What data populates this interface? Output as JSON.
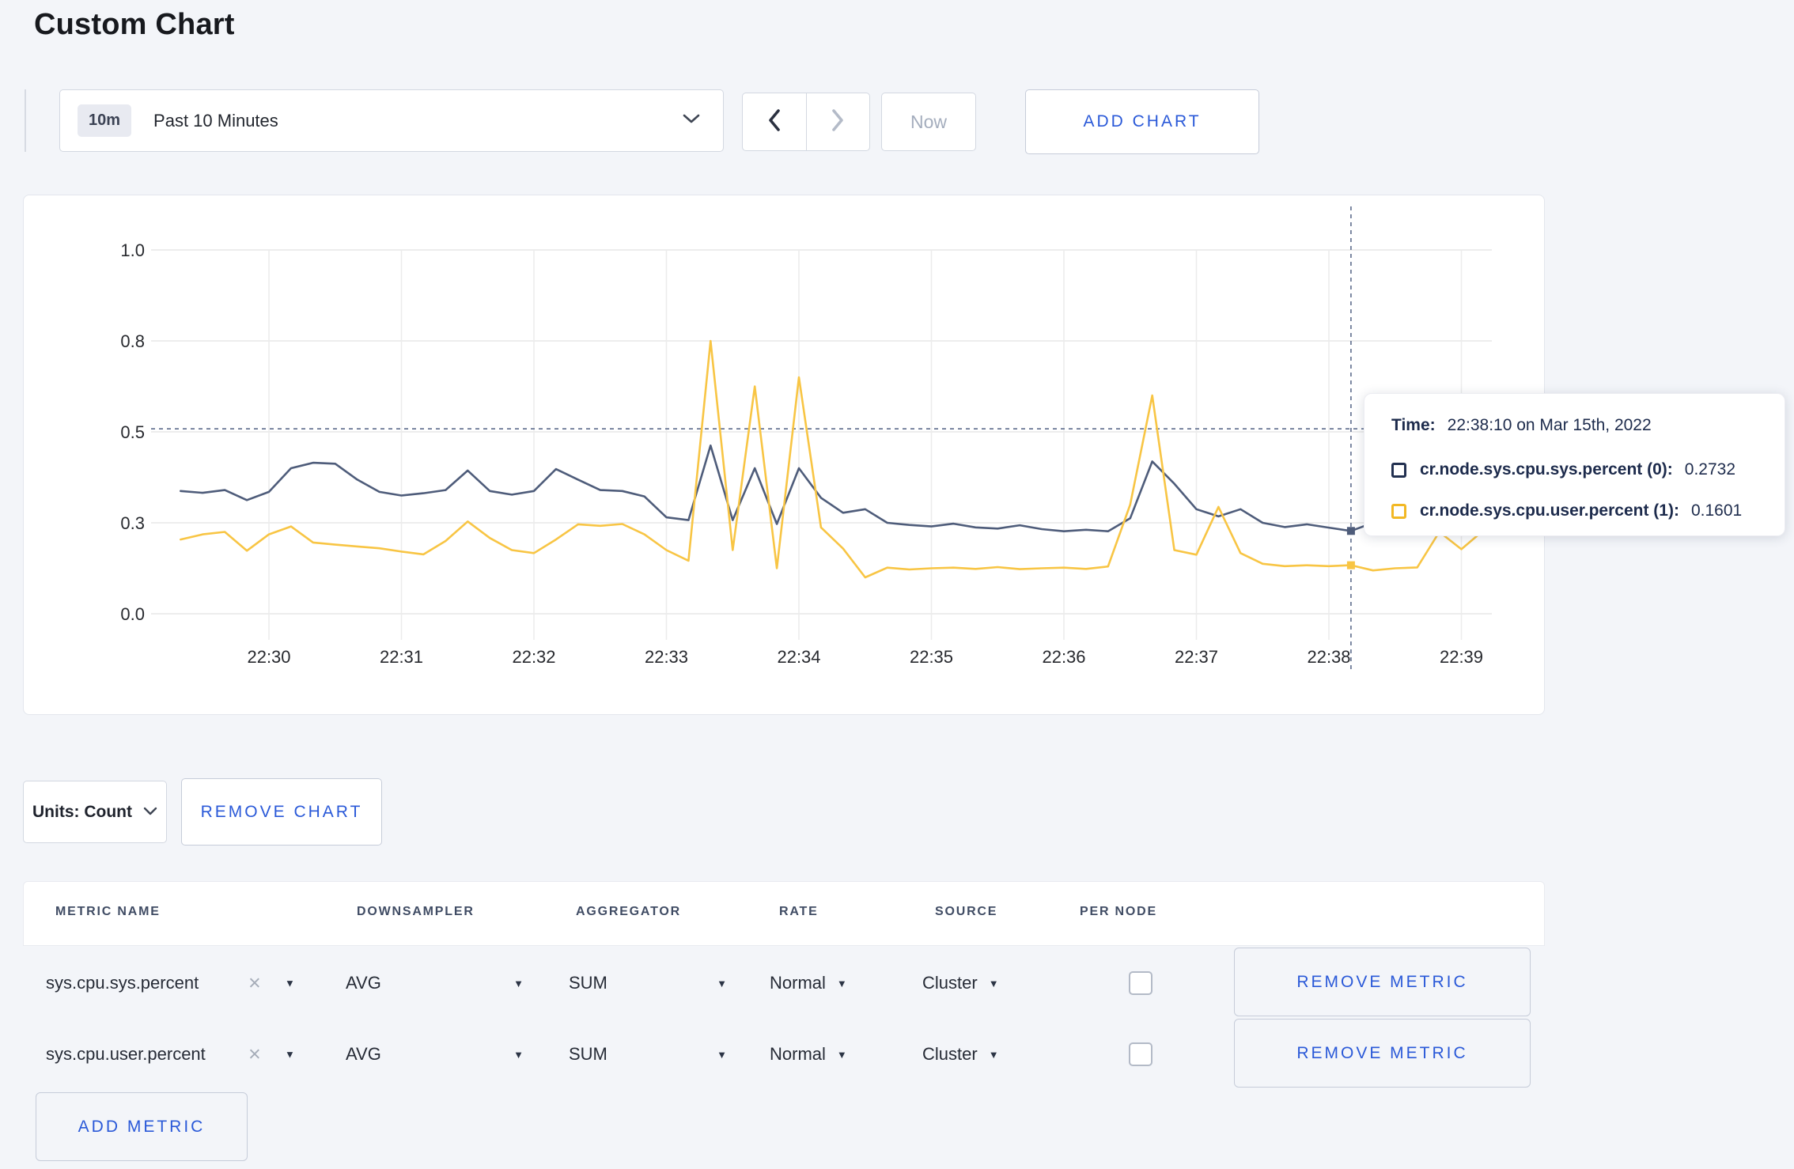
{
  "header": {
    "title": "Custom Chart"
  },
  "toolbar": {
    "time_badge": "10m",
    "time_range_label": "Past 10 Minutes",
    "now_label": "Now",
    "add_chart_label": "ADD CHART"
  },
  "chart_controls": {
    "units_label": "Units: Count",
    "remove_chart_label": "REMOVE CHART"
  },
  "tooltip": {
    "time_label": "Time:",
    "time_value": "22:38:10 on Mar 15th, 2022",
    "series": [
      {
        "label": "cr.node.sys.cpu.sys.percent (0):",
        "value": "0.2732",
        "swatch": "#223050"
      },
      {
        "label": "cr.node.sys.cpu.user.percent (1):",
        "value": "0.1601",
        "swatch": "#f2b824"
      }
    ]
  },
  "metrics_table": {
    "headers": [
      "METRIC NAME",
      "DOWNSAMPLER",
      "AGGREGATOR",
      "RATE",
      "SOURCE",
      "PER NODE"
    ],
    "rows": [
      {
        "metric": "sys.cpu.sys.percent",
        "downsampler": "AVG",
        "aggregator": "SUM",
        "rate": "Normal",
        "source": "Cluster",
        "per_node_checked": false,
        "remove_label": "REMOVE METRIC"
      },
      {
        "metric": "sys.cpu.user.percent",
        "downsampler": "AVG",
        "aggregator": "SUM",
        "rate": "Normal",
        "source": "Cluster",
        "per_node_checked": false,
        "remove_label": "REMOVE METRIC"
      }
    ],
    "add_metric_label": "ADD METRIC"
  },
  "colors": {
    "accent_blue": "#2a59d8",
    "page_background": "#f3f5f9",
    "crosshair": "#5d6c8c",
    "gridline": "#e7e7e7"
  },
  "chart_data": {
    "type": "line",
    "title": "",
    "xlabel": "",
    "ylabel": "",
    "x_axis": {
      "tick_labels": [
        "22:30",
        "22:31",
        "22:32",
        "22:33",
        "22:34",
        "22:35",
        "22:36",
        "22:37",
        "22:38",
        "22:39"
      ],
      "tick_offsets_sec": [
        0,
        60,
        120,
        180,
        240,
        300,
        360,
        420,
        480,
        540
      ]
    },
    "y_axis": {
      "ticks": [
        0.0,
        0.3,
        0.5,
        0.8,
        1.0
      ]
    },
    "sampling": {
      "start_offset_sec": -40,
      "step_sec": 10
    },
    "legend": "none",
    "grid": true,
    "series": [
      {
        "name": "cr.node.sys.cpu.sys.percent",
        "color": "#4e5c7a",
        "values": [
          0.37,
          0.366,
          0.372,
          0.35,
          0.368,
          0.42,
          0.432,
          0.43,
          0.395,
          0.368,
          0.36,
          0.365,
          0.372,
          0.415,
          0.37,
          0.362,
          0.37,
          0.418,
          0.395,
          0.372,
          0.37,
          0.358,
          0.312,
          0.306,
          0.47,
          0.306,
          0.42,
          0.296,
          0.42,
          0.355,
          0.322,
          0.33,
          0.3,
          0.293,
          0.288,
          0.297,
          0.285,
          0.281,
          0.292,
          0.279,
          0.272,
          0.277,
          0.272,
          0.31,
          0.435,
          0.386,
          0.33,
          0.314,
          0.33,
          0.3,
          0.286,
          0.295,
          0.284,
          0.2732,
          0.3,
          0.294,
          0.29,
          0.29,
          0.286,
          0.29
        ]
      },
      {
        "name": "cr.node.sys.cpu.user.percent",
        "color": "#f8c544",
        "values": [
          0.245,
          0.262,
          0.27,
          0.208,
          0.262,
          0.288,
          0.235,
          0.228,
          0.222,
          0.216,
          0.205,
          0.196,
          0.24,
          0.303,
          0.25,
          0.21,
          0.2,
          0.245,
          0.295,
          0.29,
          0.296,
          0.262,
          0.21,
          0.175,
          0.8,
          0.21,
          0.65,
          0.15,
          0.68,
          0.285,
          0.215,
          0.12,
          0.152,
          0.146,
          0.15,
          0.152,
          0.148,
          0.154,
          0.147,
          0.15,
          0.152,
          0.148,
          0.156,
          0.34,
          0.62,
          0.21,
          0.195,
          0.335,
          0.2,
          0.165,
          0.157,
          0.16,
          0.157,
          0.1601,
          0.143,
          0.15,
          0.153,
          0.27,
          0.213,
          0.275
        ]
      }
    ],
    "hover": {
      "time_offset_sec": 490,
      "hline_value": 0.51,
      "point_values": [
        0.2732,
        0.1601
      ]
    }
  }
}
